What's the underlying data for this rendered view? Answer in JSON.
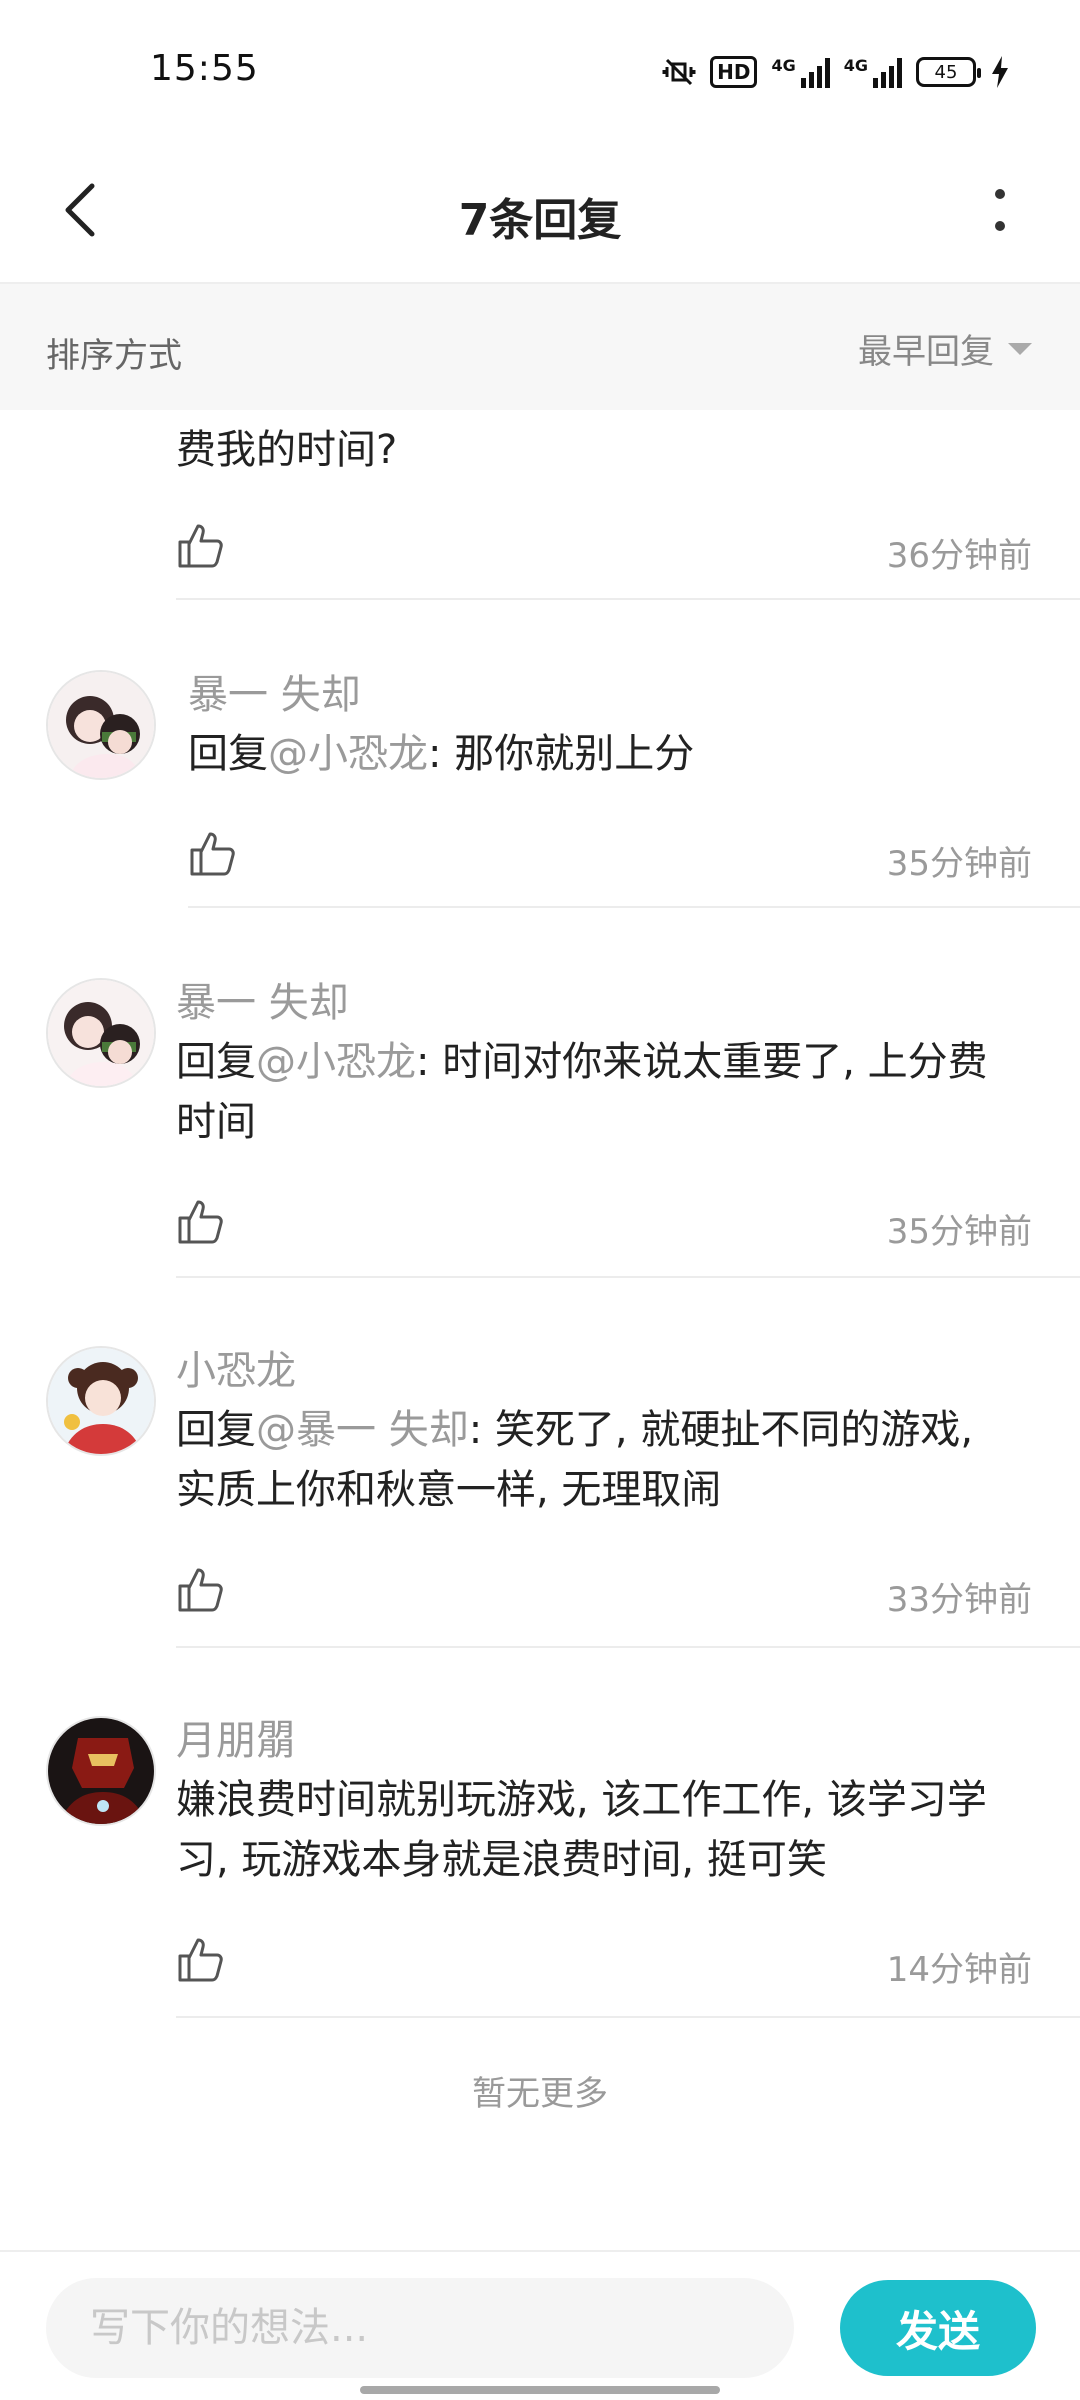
{
  "status_bar": {
    "time": "15:55",
    "hd_label": "HD",
    "net1": "4G",
    "net2": "4G",
    "battery": "45"
  },
  "header": {
    "title": "7条回复",
    "back_icon": "chevron-left-icon",
    "more_icon": "more-vertical-icon"
  },
  "sort": {
    "label": "排序方式",
    "selected": "最早回复"
  },
  "replies": [
    {
      "content_partial": "费我的时间?",
      "time": "36分钟前"
    },
    {
      "username": "暴一 失却",
      "reply_prefix": "回复",
      "mention": "@小恐龙",
      "text": ": 那你就别上分",
      "time": "35分钟前"
    },
    {
      "username": "暴一 失却",
      "reply_prefix": "回复",
      "mention": "@小恐龙",
      "text": ": 时间对你来说太重要了, 上分费时间",
      "time": "35分钟前"
    },
    {
      "username": "小恐龙",
      "reply_prefix": "回复",
      "mention": "@暴一 失却",
      "text": ": 笑死了, 就硬扯不同的游戏, 实质上你和秋意一样, 无理取闹",
      "time": "33分钟前"
    },
    {
      "username": "月朋朤",
      "text": "嫌浪费时间就别玩游戏, 该工作工作, 该学习学习, 玩游戏本身就是浪费时间, 挺可笑",
      "time": "14分钟前"
    }
  ],
  "no_more": "暂无更多",
  "composer": {
    "placeholder": "写下你的想法...",
    "send_label": "发送"
  },
  "colors": {
    "accent": "#1ec0cc",
    "muted": "#9a9a9a",
    "sort_bg": "#f7f7f7"
  }
}
